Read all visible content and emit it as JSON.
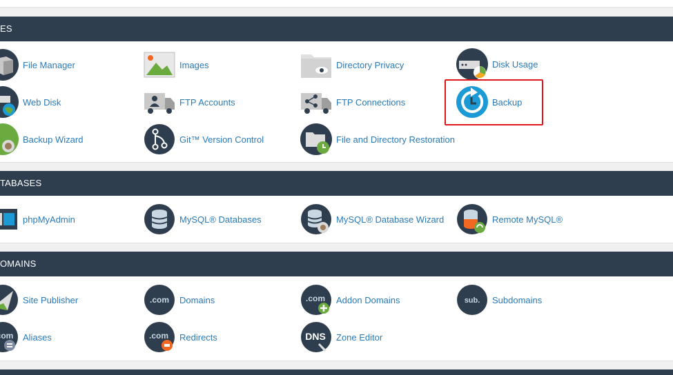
{
  "sections": {
    "files": {
      "title": "ES",
      "items": [
        {
          "label": "File Manager",
          "icon": "file-manager-icon"
        },
        {
          "label": "Images",
          "icon": "images-icon"
        },
        {
          "label": "Directory Privacy",
          "icon": "directory-privacy-icon"
        },
        {
          "label": "Disk Usage",
          "icon": "disk-usage-icon"
        },
        {
          "label": "Web Disk",
          "icon": "web-disk-icon"
        },
        {
          "label": "FTP Accounts",
          "icon": "ftp-accounts-icon"
        },
        {
          "label": "FTP Connections",
          "icon": "ftp-connections-icon"
        },
        {
          "label": "Backup",
          "icon": "backup-icon"
        },
        {
          "label": "Backup Wizard",
          "icon": "backup-wizard-icon"
        },
        {
          "label": "Git™ Version Control",
          "icon": "git-icon"
        },
        {
          "label": "File and Directory Restoration",
          "icon": "file-restore-icon"
        }
      ]
    },
    "databases": {
      "title": "TABASES",
      "items": [
        {
          "label": "phpMyAdmin",
          "icon": "phpmyadmin-icon"
        },
        {
          "label": "MySQL® Databases",
          "icon": "mysql-databases-icon"
        },
        {
          "label": "MySQL® Database Wizard",
          "icon": "mysql-wizard-icon"
        },
        {
          "label": "Remote MySQL®",
          "icon": "remote-mysql-icon"
        }
      ]
    },
    "domains": {
      "title": "OMAINS",
      "items": [
        {
          "label": "Site Publisher",
          "icon": "site-publisher-icon"
        },
        {
          "label": "Domains",
          "icon": "domains-icon",
          "badge": ".com"
        },
        {
          "label": "Addon Domains",
          "icon": "addon-domains-icon",
          "badge": ".com"
        },
        {
          "label": "Subdomains",
          "icon": "subdomains-icon",
          "badge": "sub."
        },
        {
          "label": "Aliases",
          "icon": "aliases-icon",
          "badge": "com"
        },
        {
          "label": "Redirects",
          "icon": "redirects-icon",
          "badge": ".com"
        },
        {
          "label": "Zone Editor",
          "icon": "zone-editor-icon",
          "badge": "DNS"
        }
      ]
    }
  },
  "colors": {
    "header_bg": "#2f3e4e",
    "link": "#2a7ab8",
    "highlight": "#e0161d",
    "icon_dark": "#2f3e4e",
    "icon_blue": "#1b9ad6",
    "icon_green": "#6aaa3f",
    "icon_orange": "#f26722"
  }
}
